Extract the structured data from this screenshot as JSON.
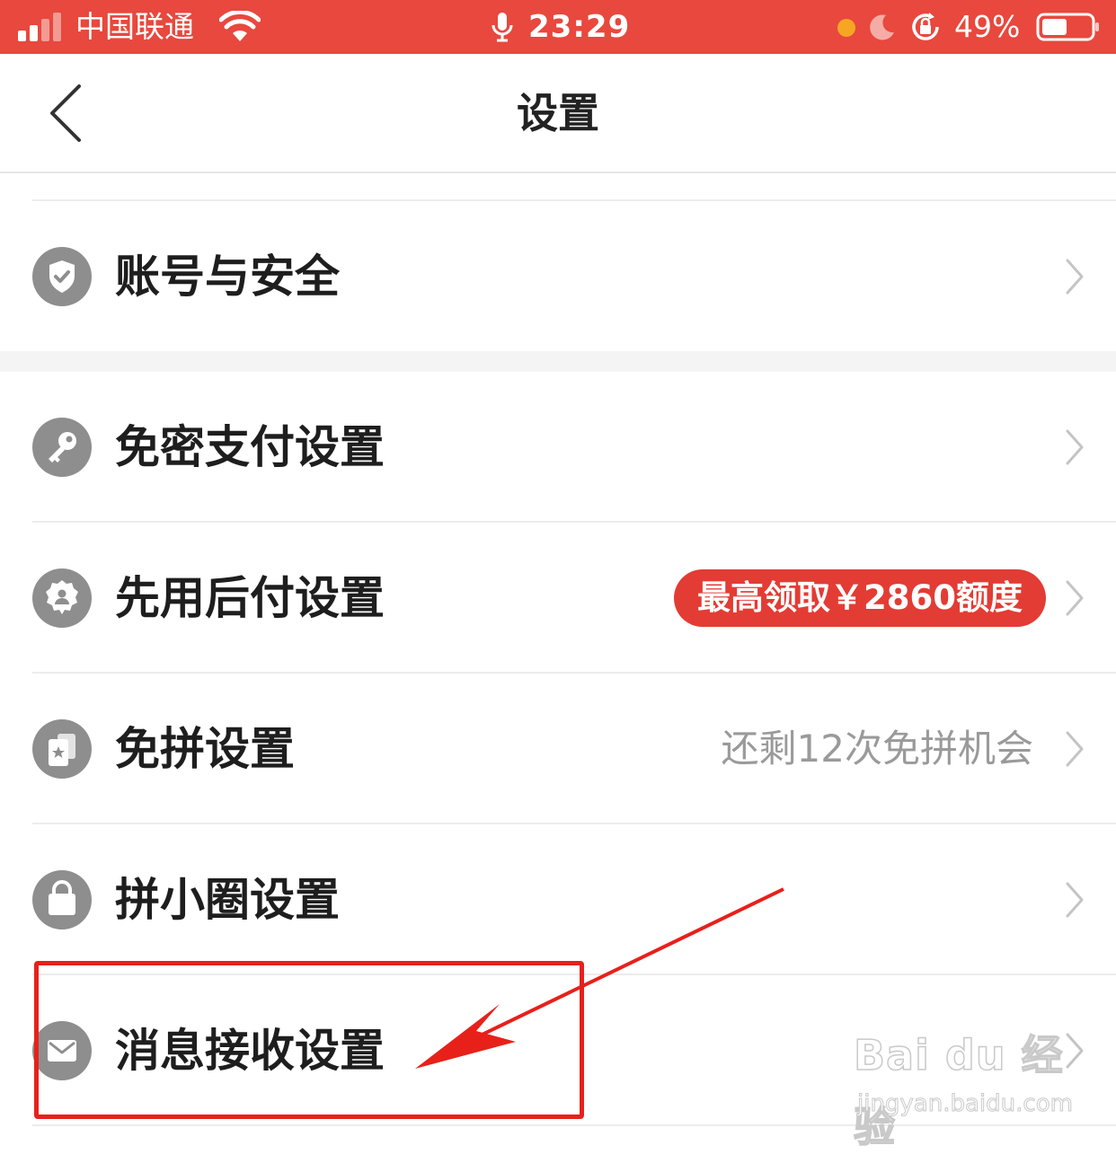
{
  "status_bar": {
    "carrier": "中国联通",
    "time": "23:29",
    "battery": "49%",
    "dot_color": "#f6a623",
    "background": "#e8483d"
  },
  "nav": {
    "title": "设置",
    "back_icon": "chevron-left-icon"
  },
  "list": {
    "items": [
      {
        "label": "账号与安全",
        "icon": "shield-check-icon"
      },
      {
        "label": "免密支付设置",
        "icon": "key-icon"
      },
      {
        "label": "先用后付设置",
        "icon": "badge-person-icon",
        "badge": "最高领取￥2860额度"
      },
      {
        "label": "免拼设置",
        "icon": "star-cards-icon",
        "extra": "还剩12次免拼机会"
      },
      {
        "label": "拼小圈设置",
        "icon": "bag-icon"
      },
      {
        "label": "消息接收设置",
        "icon": "mail-icon"
      }
    ],
    "badge_color": "#e33c34",
    "chevron_icon": "chevron-right-icon"
  },
  "annotation": {
    "color": "#e8201a",
    "target": "消息接收设置"
  },
  "watermark": {
    "logo": "Bai du 经验",
    "url": "jingyan.baidu.com"
  }
}
